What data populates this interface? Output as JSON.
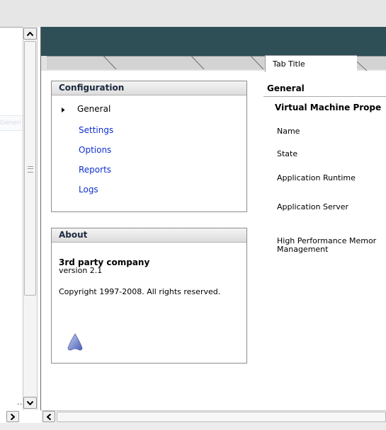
{
  "left_panel": {
    "snippet_text": "Generi",
    "trailing_text": ".."
  },
  "tabs": {
    "inactive_count": 4,
    "active_label": "Tab Title"
  },
  "configuration": {
    "title": "Configuration",
    "current": "General",
    "links": [
      "Settings",
      "Options",
      "Reports",
      "Logs"
    ]
  },
  "about": {
    "title": "About",
    "company": "3rd party company",
    "version": "version 2.1",
    "copyright": "Copyright 1997-2008.  All rights reserved.",
    "logo_icon": "product-logo-icon"
  },
  "general": {
    "title": "General",
    "subtitle": "Virtual Machine Prope",
    "properties": [
      "Name",
      "State",
      "Application Runtime",
      "Application Server",
      "High Performance Memor\nManagement"
    ]
  },
  "icons": {
    "scroll_up": "scroll-up-icon",
    "scroll_down": "scroll-down-icon",
    "scroll_left": "scroll-left-icon",
    "expand": "expand-arrow-icon",
    "bullet": "bullet-arrow-icon"
  },
  "colors": {
    "banner": "#2f4f57",
    "link": "#0f2fd0",
    "header_text": "#1c2a3e"
  }
}
